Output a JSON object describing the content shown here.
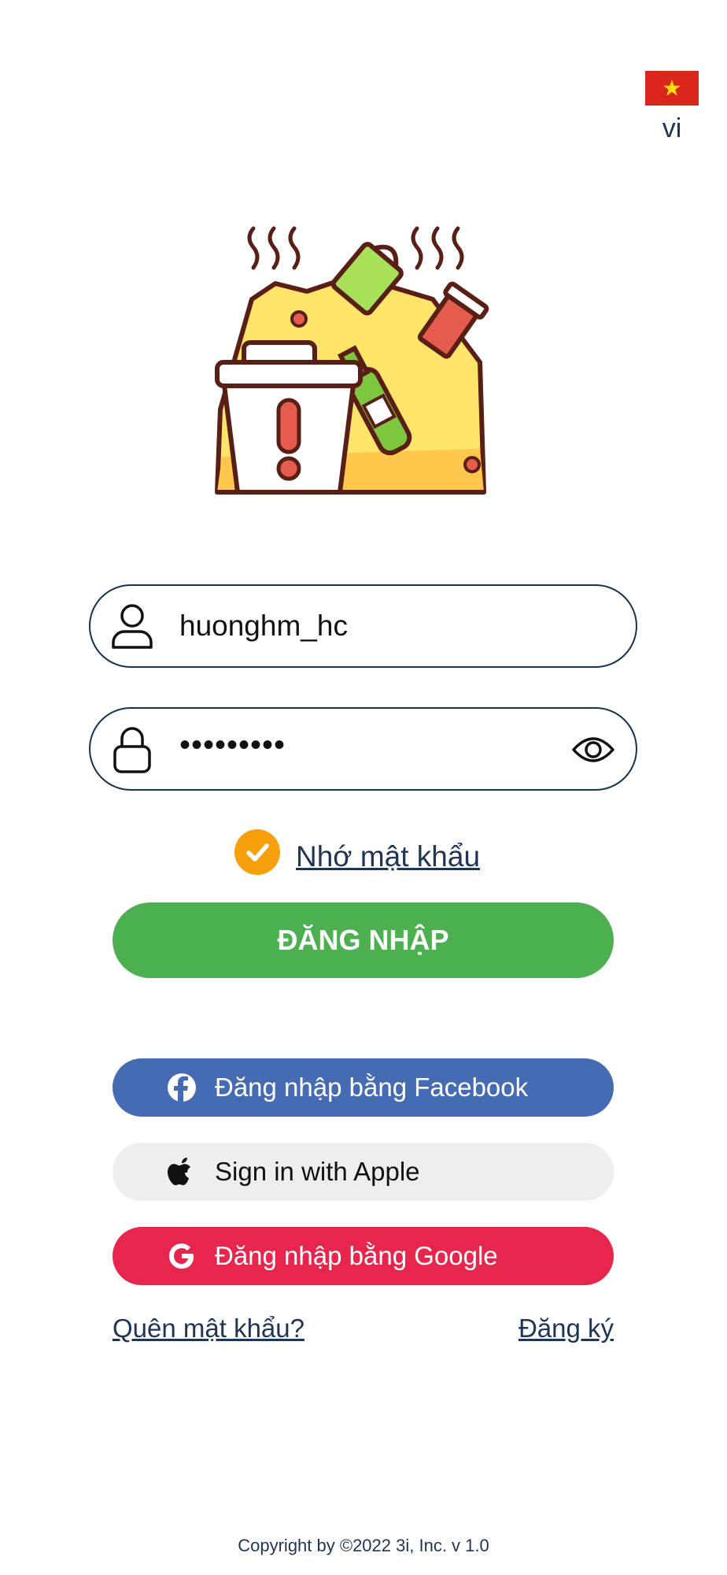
{
  "language": {
    "code": "vi",
    "flag_icon": "vietnam-flag-icon"
  },
  "illustration": {
    "icon": "garbage-pile-illustration"
  },
  "username_field": {
    "value": "huonghm_hc",
    "icon": "user-icon"
  },
  "password_field": {
    "masked_value": "•••••••••",
    "icon": "lock-icon",
    "toggle_icon": "eye-icon"
  },
  "remember": {
    "label": "Nhớ mật khẩu",
    "checked": true
  },
  "login_button": {
    "label": "ĐĂNG NHẬP",
    "color": "#4caf50"
  },
  "social": {
    "facebook": {
      "label": "Đăng nhập bằng Facebook",
      "icon": "facebook-icon",
      "color": "#456cb3"
    },
    "apple": {
      "label": "Sign in with Apple",
      "icon": "apple-icon",
      "color": "#eeeeee"
    },
    "google": {
      "label": "Đăng nhập bằng Google",
      "icon": "google-icon",
      "color": "#e8264d"
    }
  },
  "links": {
    "forgot": "Quên mật khẩu?",
    "register": "Đăng ký"
  },
  "footer": {
    "copyright": "Copyright by ©2022 3i, Inc. v 1.0"
  },
  "colors": {
    "accent": "#f7a00c",
    "text_dark": "#1f3556",
    "border": "#15324f"
  }
}
